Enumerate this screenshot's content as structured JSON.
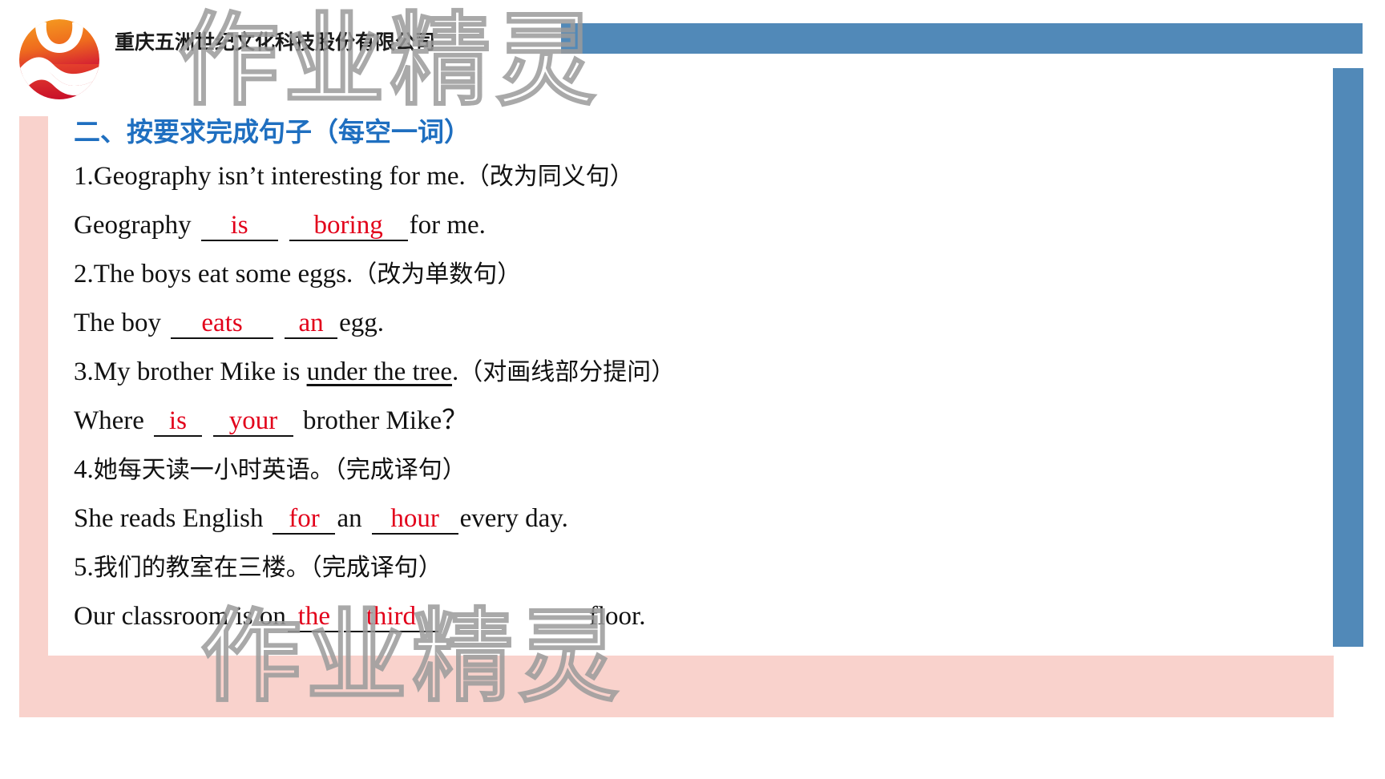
{
  "header": {
    "company_name": "重庆五洲世纪文化科技股份有限公司",
    "logo_icon": "sun-wave-logo-icon",
    "accent_blue": "#5189B8",
    "accent_pink": "#F9D2CC"
  },
  "watermark": {
    "text_top": "作业精灵",
    "text_bottom": "作业精灵"
  },
  "exercise": {
    "section_title": "二、按要求完成句子（每空一词）",
    "title_color": "#1F6FC0",
    "answer_color": "#E2001A",
    "items": [
      {
        "number": "1.",
        "prompt_en": "Geography isn’t interesting for me.",
        "prompt_cn": "（改为同义句）",
        "answer_prefix": "Geography",
        "blank1": "is",
        "blank2": "boring",
        "answer_suffix": "for me."
      },
      {
        "number": "2.",
        "prompt_en": "The boys eat some eggs.",
        "prompt_cn": "（改为单数句）",
        "answer_prefix": "The boy",
        "blank1": "eats",
        "blank2": "an",
        "answer_suffix": "egg."
      },
      {
        "number": "3.",
        "prompt_en_pre": "My brother Mike is ",
        "prompt_en_underlined": "under the tree",
        "prompt_en_post": ".",
        "prompt_cn": "（对画线部分提问）",
        "answer_prefix": "Where",
        "blank1": "is",
        "blank2": "your",
        "answer_suffix": "brother Mike？"
      },
      {
        "number": "4.",
        "prompt_cn_full": "她每天读一小时英语。（完成译句）",
        "answer_prefix": "She reads English",
        "blank1": "for",
        "answer_middle": "an",
        "blank2": "hour",
        "answer_suffix": "every day."
      },
      {
        "number": "5.",
        "prompt_cn_full": "我们的教室在三楼。（完成译句）",
        "answer_prefix": "Our classroom is on",
        "blank1": "the",
        "blank2": "third",
        "answer_suffix": "floor."
      }
    ]
  }
}
